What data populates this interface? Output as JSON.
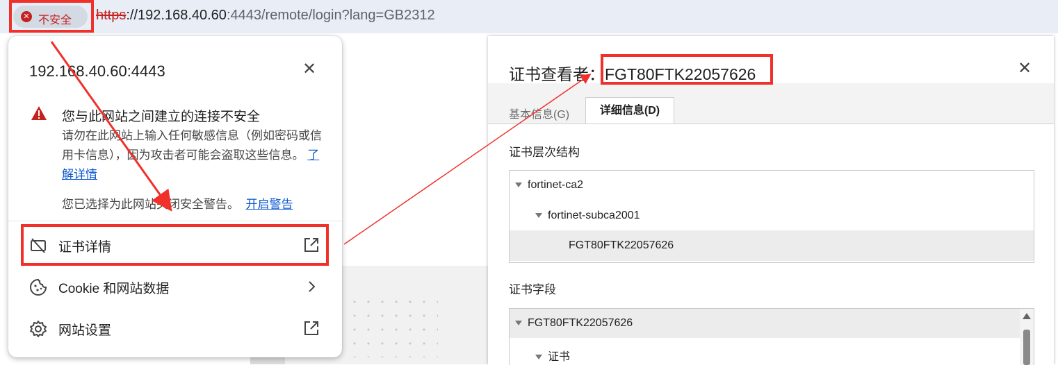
{
  "address_bar": {
    "security_chip_label": "不安全",
    "url_protocol": "https",
    "url_host": "://192.168.40.60",
    "url_rest": ":4443/remote/login?lang=GB2312"
  },
  "site_popup": {
    "host": "192.168.40.60:4443",
    "warning_title": "您与此网站之间建立的连接不安全",
    "warning_body": "请勿在此网站上输入任何敏感信息（例如密码或信用卡信息），因为攻击者可能会盗取这些信息。",
    "learn_more": "了解详情",
    "closed_warning_note": "您已选择为此网站关闭安全警告。",
    "enable_warning": "开启警告",
    "menu": {
      "cert_details": "证书详情",
      "cookies": "Cookie 和网站数据",
      "site_settings": "网站设置"
    }
  },
  "cert_viewer": {
    "title_prefix": "证书查看者：",
    "cert_name": "FGT80FTK22057626",
    "tabs": [
      "基本信息(G)",
      "详细信息(D)"
    ],
    "hierarchy_label": "证书层次结构",
    "hierarchy": [
      "fortinet-ca2",
      "fortinet-subca2001",
      "FGT80FTK22057626"
    ],
    "fields_label": "证书字段",
    "fields": [
      "FGT80FTK22057626",
      "证书"
    ]
  },
  "colors": {
    "danger": "#c5221f",
    "link": "#0b57d0",
    "annotation": "#f0302a"
  }
}
